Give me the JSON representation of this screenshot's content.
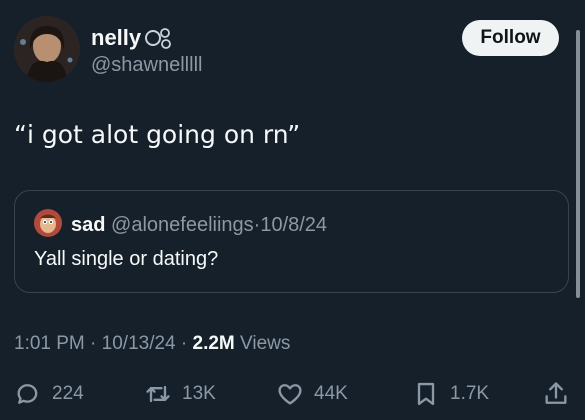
{
  "author": {
    "display_name": "nelly",
    "handle": "@shawnelllll"
  },
  "follow_label": "Follow",
  "tweet_text": "“i got alot going on rn”",
  "quote": {
    "name": "sad",
    "handle": "@alonefeeliings",
    "separator": "·",
    "date": "10/8/24",
    "text": "Yall single or dating?"
  },
  "meta": {
    "time": "1:01 PM",
    "date": "10/13/24",
    "separator": "·",
    "views_count": "2.2M",
    "views_label": "Views"
  },
  "actions": {
    "replies": "224",
    "reposts": "13K",
    "likes": "44K",
    "bookmarks": "1.7K"
  },
  "icons": {
    "reply": "reply-icon",
    "repost": "repost-icon",
    "like": "heart-icon",
    "bookmark": "bookmark-icon",
    "share": "share-icon",
    "name_emoji": "bubbles-icon"
  },
  "colors": {
    "background": "#15202b",
    "text_primary": "#f7f9f9",
    "text_secondary": "#8b98a5",
    "border": "#38444d",
    "follow_bg": "#eff3f4"
  }
}
